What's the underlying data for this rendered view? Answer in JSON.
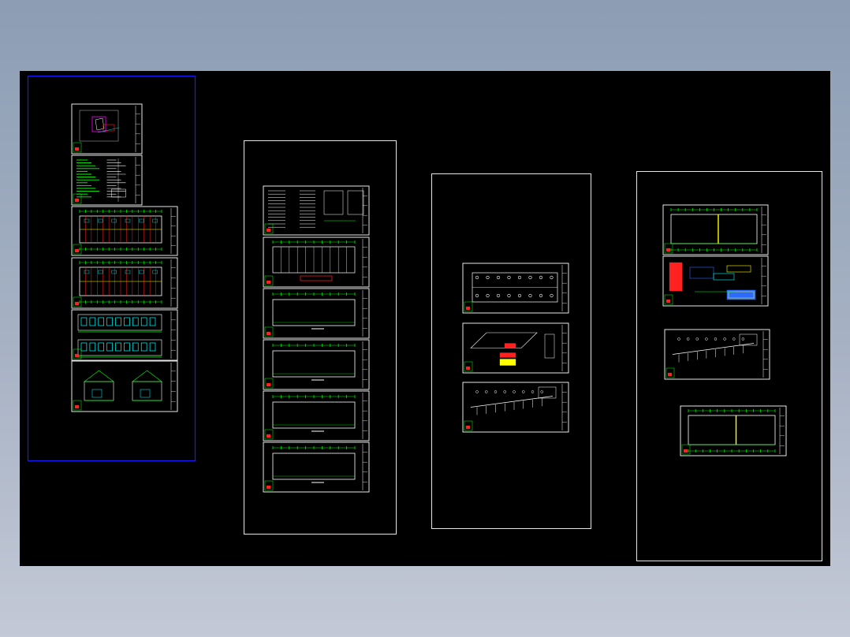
{
  "viewer": {
    "background": "#000000",
    "colors": {
      "frame": "#ffffff",
      "selection": "#1a1aff",
      "dim": "#00ff00",
      "red": "#ff2020",
      "yellow": "#ffff00",
      "cyan": "#00ffff",
      "magenta": "#ff00ff",
      "blue": "#2b6cff",
      "gray": "#bbbbbb"
    }
  },
  "groups": [
    {
      "id": "group-1",
      "selected": true,
      "sheets": [
        "site-plan",
        "design-notes",
        "floor-plan",
        "floor-plan",
        "elevations",
        "sections"
      ]
    },
    {
      "id": "group-2",
      "selected": false,
      "sheets": [
        "notes-table",
        "roof-plan",
        "plan-simple",
        "plan-simple",
        "plan-simple",
        "plan-simple"
      ]
    },
    {
      "id": "group-3",
      "selected": false,
      "sheets": [
        "lighting-plan",
        "system-diagram",
        "riser-diagram"
      ]
    },
    {
      "id": "group-4",
      "selected": false,
      "sheets": [
        "wall-plan",
        "legend-sheet",
        "riser-diagram",
        "wall-plan"
      ]
    }
  ]
}
